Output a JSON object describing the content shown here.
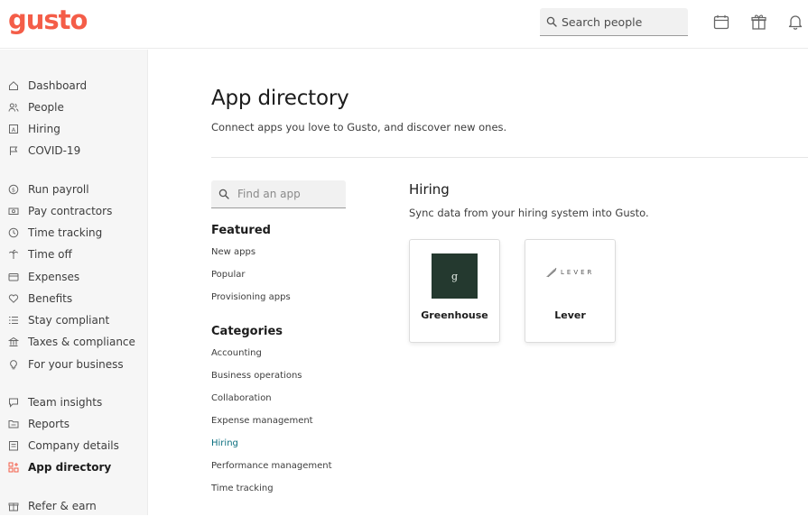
{
  "brand": {
    "logo_text": "gusto",
    "color": "#f45d48"
  },
  "header": {
    "search_placeholder": "Search people",
    "icons": [
      "calendar-icon",
      "gift-icon",
      "bell-icon"
    ]
  },
  "sidebar": {
    "items": [
      {
        "label": "Dashboard",
        "icon": "home-icon"
      },
      {
        "label": "People",
        "icon": "people-icon"
      },
      {
        "label": "Hiring",
        "icon": "hiring-icon"
      },
      {
        "label": "COVID-19",
        "icon": "flag-icon"
      },
      {
        "label": "Run payroll",
        "icon": "dollar-icon"
      },
      {
        "label": "Pay contractors",
        "icon": "cash-icon"
      },
      {
        "label": "Time tracking",
        "icon": "clock-icon"
      },
      {
        "label": "Time off",
        "icon": "palm-tree-icon"
      },
      {
        "label": "Expenses",
        "icon": "card-icon"
      },
      {
        "label": "Benefits",
        "icon": "heart-icon"
      },
      {
        "label": "Stay compliant",
        "icon": "list-icon"
      },
      {
        "label": "Taxes & compliance",
        "icon": "building-icon"
      },
      {
        "label": "For your business",
        "icon": "lightbulb-icon"
      },
      {
        "label": "Team insights",
        "icon": "chat-bubble-icon"
      },
      {
        "label": "Reports",
        "icon": "folder-icon"
      },
      {
        "label": "Company details",
        "icon": "company-icon"
      },
      {
        "label": "App directory",
        "icon": "apps-grid-icon",
        "active": true
      },
      {
        "label": "Refer & earn",
        "icon": "gift-icon"
      }
    ]
  },
  "main": {
    "title": "App directory",
    "subtitle": "Connect apps you love to Gusto, and discover new ones.",
    "find_placeholder": "Find an app",
    "featured_heading": "Featured",
    "featured_links": [
      "New apps",
      "Popular",
      "Provisioning apps"
    ],
    "categories_heading": "Categories",
    "category_links": [
      "Accounting",
      "Business operations",
      "Collaboration",
      "Expense management",
      "Hiring",
      "Performance management",
      "Time tracking"
    ],
    "active_category": "Hiring",
    "section": {
      "title": "Hiring",
      "description": "Sync data from your hiring system into Gusto.",
      "apps": [
        {
          "name": "Greenhouse",
          "logo_text": "g"
        },
        {
          "name": "Lever",
          "logo_text": "LEVER"
        }
      ]
    }
  },
  "colors": {
    "accent": "#f45d48",
    "link_active": "#0a6e7e",
    "greenhouse_logo_bg": "#24392f",
    "sidebar_bg": "#f6f6f6"
  }
}
